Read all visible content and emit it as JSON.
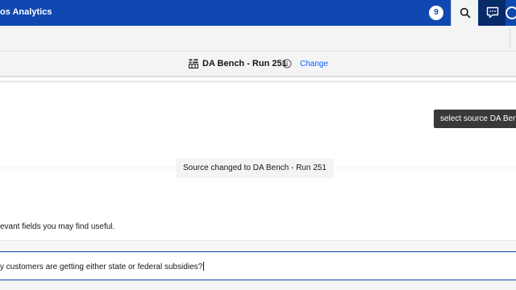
{
  "header": {
    "app_title": "os Analytics",
    "notification_count": "9",
    "bar_color": "#0f48b0"
  },
  "source": {
    "name": "DA Bench - Run 251",
    "change_label": "Change",
    "icon": "dataset-icon"
  },
  "tooltip": {
    "text": "select source DA Bench"
  },
  "conversation": {
    "status_message": "Source changed to DA Bench - Run 251",
    "helper_text": "evant fields you may find useful."
  },
  "composer": {
    "value": "y customers are getting either state or federal subsidies?"
  }
}
